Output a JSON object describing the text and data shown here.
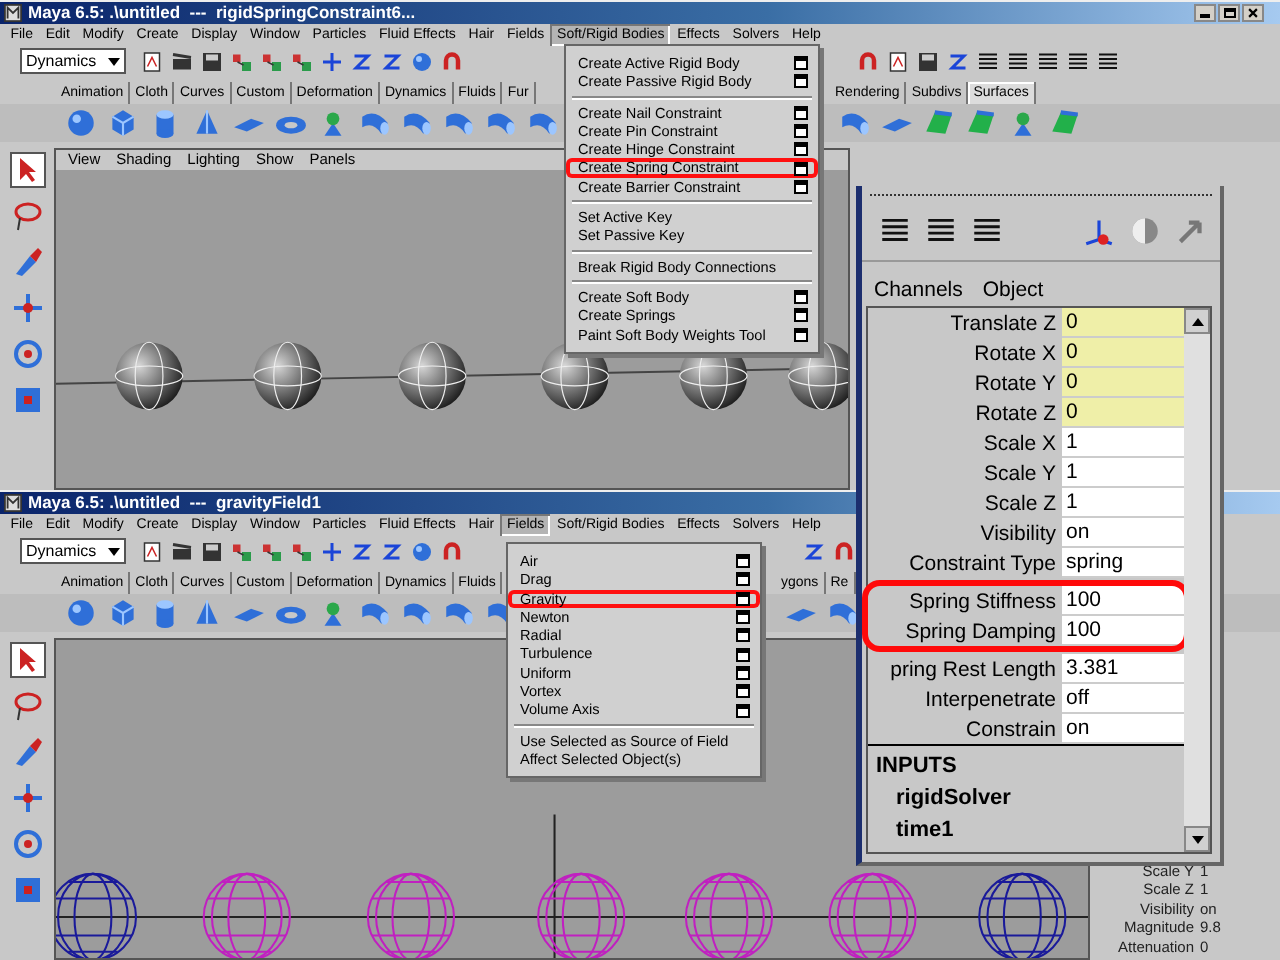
{
  "windows": [
    {
      "title": "Maya 6.5: .\\untitled  ---  rigidSpringConstraint6...",
      "menus": [
        {
          "label": "File",
          "selected": false
        },
        {
          "label": "Edit",
          "selected": false
        },
        {
          "label": "Modify",
          "selected": false
        },
        {
          "label": "Create",
          "selected": false
        },
        {
          "label": "Display",
          "selected": false
        },
        {
          "label": "Window",
          "selected": false
        },
        {
          "label": "Particles",
          "selected": false
        },
        {
          "label": "Fluid Effects",
          "selected": false
        },
        {
          "label": "Hair",
          "selected": false
        },
        {
          "label": "Fields",
          "selected": false
        },
        {
          "label": "Soft/Rigid Bodies",
          "selected": true
        },
        {
          "label": "Effects",
          "selected": false
        },
        {
          "label": "Solvers",
          "selected": false
        },
        {
          "label": "Help",
          "selected": false
        }
      ],
      "mode": "Dynamics",
      "shelf_tabs_left": [
        {
          "label": "Animation",
          "selected": false
        },
        {
          "label": "Cloth",
          "selected": false
        },
        {
          "label": "Curves",
          "selected": false
        },
        {
          "label": "Custom",
          "selected": false
        },
        {
          "label": "Deformation",
          "selected": false
        },
        {
          "label": "Dynamics",
          "selected": false
        },
        {
          "label": "Fluids",
          "selected": false
        },
        {
          "label": "Fur",
          "selected": false
        }
      ],
      "shelf_tabs_right": [
        {
          "label": "Rendering",
          "selected": false
        },
        {
          "label": "Subdivs",
          "selected": false
        },
        {
          "label": "Surfaces",
          "selected": true
        }
      ],
      "panel_menus": [
        "View",
        "Shading",
        "Lighting",
        "Show",
        "Panels"
      ],
      "open_menu": {
        "groups": [
          [
            {
              "label": "Create Active Rigid Body",
              "option_box": true,
              "highlighted": false
            },
            {
              "label": "Create Passive Rigid Body",
              "option_box": true,
              "highlighted": false
            }
          ],
          [
            {
              "label": "Create Nail Constraint",
              "option_box": true,
              "highlighted": false
            },
            {
              "label": "Create Pin Constraint",
              "option_box": true,
              "highlighted": false
            },
            {
              "label": "Create Hinge Constraint",
              "option_box": true,
              "highlighted": false
            },
            {
              "label": "Create Spring Constraint",
              "option_box": true,
              "highlighted": true
            },
            {
              "label": "Create Barrier Constraint",
              "option_box": true,
              "highlighted": false
            }
          ],
          [
            {
              "label": "Set Active Key",
              "option_box": false,
              "highlighted": false
            },
            {
              "label": "Set Passive Key",
              "option_box": false,
              "highlighted": false
            }
          ],
          [
            {
              "label": "Break Rigid Body Connections",
              "option_box": false,
              "highlighted": false
            }
          ],
          [
            {
              "label": "Create Soft Body",
              "option_box": true,
              "highlighted": false
            },
            {
              "label": "Create Springs",
              "option_box": true,
              "highlighted": false
            },
            {
              "label": "Paint Soft Body Weights Tool",
              "option_box": true,
              "highlighted": false
            }
          ]
        ]
      }
    },
    {
      "title": "Maya 6.5: .\\untitled  ---  gravityField1",
      "menus": [
        {
          "label": "File",
          "selected": false
        },
        {
          "label": "Edit",
          "selected": false
        },
        {
          "label": "Modify",
          "selected": false
        },
        {
          "label": "Create",
          "selected": false
        },
        {
          "label": "Display",
          "selected": false
        },
        {
          "label": "Window",
          "selected": false
        },
        {
          "label": "Particles",
          "selected": false
        },
        {
          "label": "Fluid Effects",
          "selected": false
        },
        {
          "label": "Hair",
          "selected": false
        },
        {
          "label": "Fields",
          "selected": true
        },
        {
          "label": "Soft/Rigid Bodies",
          "selected": false
        },
        {
          "label": "Effects",
          "selected": false
        },
        {
          "label": "Solvers",
          "selected": false
        },
        {
          "label": "Help",
          "selected": false
        }
      ],
      "mode": "Dynamics",
      "shelf_tabs_left": [
        {
          "label": "Animation",
          "selected": false
        },
        {
          "label": "Cloth",
          "selected": false
        },
        {
          "label": "Curves",
          "selected": false
        },
        {
          "label": "Custom",
          "selected": false
        },
        {
          "label": "Deformation",
          "selected": false
        },
        {
          "label": "Dynamics",
          "selected": false
        },
        {
          "label": "Fluids",
          "selected": false
        }
      ],
      "shelf_tabs_right": [
        {
          "label": "ygons",
          "selected": false
        },
        {
          "label": "Re",
          "selected": false
        }
      ],
      "open_menu": {
        "groups": [
          [
            {
              "label": "Air",
              "option_box": true,
              "highlighted": false
            },
            {
              "label": "Drag",
              "option_box": true,
              "highlighted": false
            },
            {
              "label": "Gravity",
              "option_box": true,
              "highlighted": true
            },
            {
              "label": "Newton",
              "option_box": true,
              "highlighted": false
            },
            {
              "label": "Radial",
              "option_box": true,
              "highlighted": false
            },
            {
              "label": "Turbulence",
              "option_box": true,
              "highlighted": false
            },
            {
              "label": "Uniform",
              "option_box": true,
              "highlighted": false
            },
            {
              "label": "Vortex",
              "option_box": true,
              "highlighted": false
            },
            {
              "label": "Volume Axis",
              "option_box": true,
              "highlighted": false
            }
          ],
          [
            {
              "label": "Use Selected as Source of Field",
              "option_box": false,
              "highlighted": false
            },
            {
              "label": "Affect Selected Object(s)",
              "option_box": false,
              "highlighted": false
            }
          ]
        ]
      },
      "attributes": [
        {
          "name": "Scale Y",
          "value": "1"
        },
        {
          "name": "Scale Z",
          "value": "1"
        },
        {
          "name": "Visibility",
          "value": "on"
        },
        {
          "name": "Magnitude",
          "value": "9.8"
        },
        {
          "name": "Attenuation",
          "value": "0"
        }
      ]
    }
  ],
  "channel_box": {
    "tabs": [
      "Channels",
      "Object"
    ],
    "rows": [
      {
        "name": "Translate Z",
        "value": "0",
        "keyed": true,
        "highlighted": false
      },
      {
        "name": "Rotate X",
        "value": "0",
        "keyed": true,
        "highlighted": false
      },
      {
        "name": "Rotate Y",
        "value": "0",
        "keyed": true,
        "highlighted": false
      },
      {
        "name": "Rotate Z",
        "value": "0",
        "keyed": true,
        "highlighted": false
      },
      {
        "name": "Scale X",
        "value": "1",
        "keyed": false,
        "highlighted": false
      },
      {
        "name": "Scale Y",
        "value": "1",
        "keyed": false,
        "highlighted": false
      },
      {
        "name": "Scale Z",
        "value": "1",
        "keyed": false,
        "highlighted": false
      },
      {
        "name": "Visibility",
        "value": "on",
        "keyed": false,
        "highlighted": false
      },
      {
        "name": "Constraint Type",
        "value": "spring",
        "keyed": false,
        "highlighted": false
      },
      {
        "name": "Spring Stiffness",
        "value": "100",
        "keyed": false,
        "highlighted": true
      },
      {
        "name": "Spring Damping",
        "value": "100",
        "keyed": false,
        "highlighted": true
      },
      {
        "name": "pring Rest Length",
        "value": "3.381",
        "keyed": false,
        "highlighted": false
      },
      {
        "name": "Interpenetrate",
        "value": "off",
        "keyed": false,
        "highlighted": false
      },
      {
        "name": "Constrain",
        "value": "on",
        "keyed": false,
        "highlighted": false
      }
    ],
    "inputs_title": "INPUTS",
    "inputs": [
      "rigidSolver",
      "time1"
    ]
  }
}
